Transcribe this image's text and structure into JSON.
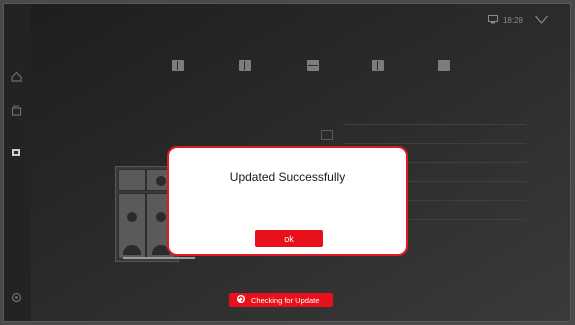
{
  "dialog": {
    "title": "Updated Successfully",
    "ok_label": "ok"
  },
  "update_status": {
    "label": "Checking for Update",
    "icon": "refresh-icon"
  },
  "status_bar": {
    "time": "18:28"
  },
  "colors": {
    "accent": "#e8101a",
    "dialog_border": "#e01a22",
    "background": "#2b2b2b"
  },
  "sidebar": {
    "items": [
      {
        "icon": "home-icon"
      },
      {
        "icon": "back-icon"
      },
      {
        "icon": "display-icon"
      },
      {
        "icon": "settings-icon"
      }
    ]
  }
}
